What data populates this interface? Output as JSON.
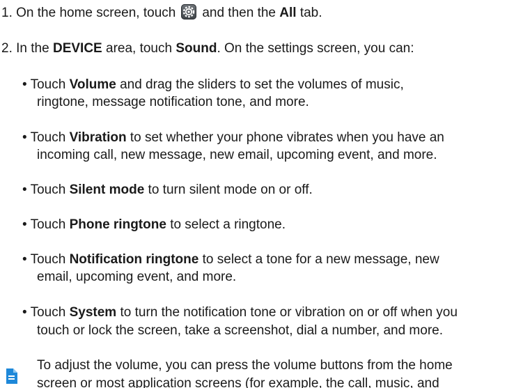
{
  "step1": {
    "num": "1.",
    "pre": "On the home screen, touch",
    "icon": "settings-icon",
    "mid": "and then the",
    "bold": "All",
    "post": "tab."
  },
  "step2": {
    "num": "2.",
    "pre": "In the",
    "bold1": "DEVICE",
    "mid": "area, touch",
    "bold2": "Sound",
    "post": ". On the settings screen, you can:"
  },
  "bullets": [
    {
      "marker": "•",
      "pre": "Touch",
      "bold": "Volume",
      "line1": "and drag the sliders to set the volumes of music,",
      "line2": "ringtone, message notification tone, and more."
    },
    {
      "marker": "•",
      "pre": "Touch",
      "bold": "Vibration",
      "line1": "to set whether your phone vibrates when you have an",
      "line2": "incoming call, new message, new email, upcoming event, and more."
    },
    {
      "marker": "•",
      "pre": "Touch",
      "bold": "Silent mode",
      "line1": "to turn silent mode on or off."
    },
    {
      "marker": "•",
      "pre": "Touch",
      "bold": "Phone ringtone",
      "line1": "to select a ringtone."
    },
    {
      "marker": "•",
      "pre": "Touch",
      "bold": "Notification ringtone",
      "line1": "to select a tone for a new message, new",
      "line2": "email, upcoming event, and more."
    },
    {
      "marker": "•",
      "pre": "Touch",
      "bold": "System",
      "line1": "to turn the notification tone or vibration on or off when you",
      "line2": "touch or lock the screen, take a screenshot, dial a number, and more."
    }
  ],
  "note": {
    "icon": "note-icon",
    "icon_color": "#1e88d9",
    "line1": "To adjust the volume, you can press the volume buttons from the home",
    "line2": "screen or most application screens (for example, the call, music, and"
  }
}
